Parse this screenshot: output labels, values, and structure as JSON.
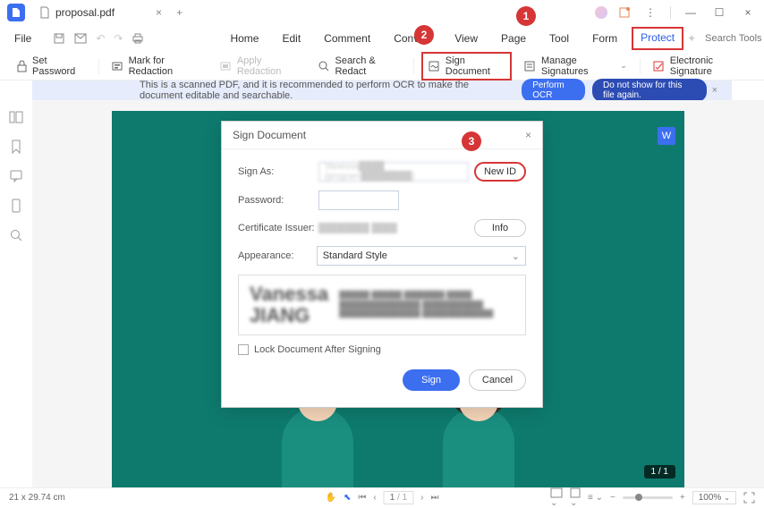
{
  "title": {
    "filename": "proposal.pdf"
  },
  "menubar": {
    "file": "File",
    "tabs": [
      "Home",
      "Edit",
      "Comment",
      "Convert",
      "View",
      "Page",
      "Tool",
      "Form",
      "Protect"
    ],
    "active_index": 8,
    "search_placeholder": "Search Tools"
  },
  "toolbar": {
    "set_password": "Set Password",
    "mark_redaction": "Mark for Redaction",
    "apply_redaction": "Apply Redaction",
    "search_redact": "Search & Redact",
    "sign_document": "Sign Document",
    "manage_signatures": "Manage Signatures",
    "electronic_signature": "Electronic Signature"
  },
  "ocr": {
    "message": "This is a scanned PDF, and it is recommended to perform OCR to make the document editable and searchable.",
    "perform": "Perform OCR",
    "dont_show": "Do not show for this file again."
  },
  "dialog": {
    "title": "Sign Document",
    "sign_as_label": "Sign As:",
    "sign_as_value": "Vanessa████ (program████████)",
    "new_id": "New ID",
    "password_label": "Password:",
    "cert_issuer_label": "Certificate Issuer:",
    "cert_issuer_value": "████████ ████",
    "info": "Info",
    "appearance_label": "Appearance:",
    "appearance_value": "Standard Style",
    "preview_name_line1": "Vanessa",
    "preview_name_line2": "JIANG",
    "preview_details": "██████ ██████ ████████ █████\n████████████████\n████████████\n████████████████\n██████████████",
    "lock_label": "Lock Document After Signing",
    "sign_btn": "Sign",
    "cancel_btn": "Cancel"
  },
  "callouts": {
    "c1": "1",
    "c2": "2",
    "c3": "3"
  },
  "status": {
    "dimensions": "21 x 29.74 cm",
    "page_current": "1",
    "page_total": "/ 1",
    "page_counter": "1 / 1",
    "zoom": "100%"
  }
}
